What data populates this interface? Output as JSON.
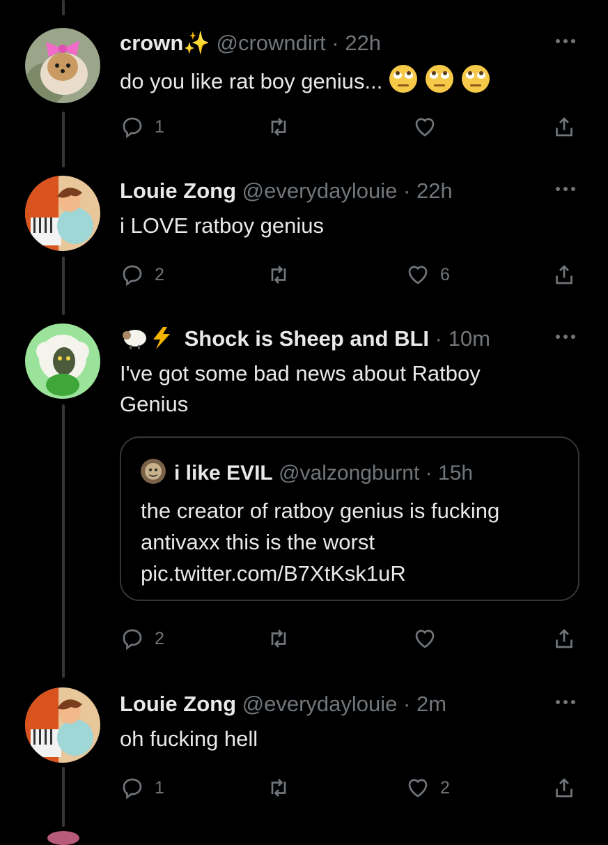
{
  "tweets": [
    {
      "name": "crown✨",
      "handle": "@crowndirt",
      "separator": "·",
      "time": "22h",
      "text": "do you like rat boy genius...",
      "emoji": "🙄🙄🙄",
      "replies": "1",
      "retweets": "",
      "likes": ""
    },
    {
      "name": "Louie Zong",
      "handle": "@everydaylouie",
      "separator": "·",
      "time": "22h",
      "text": "i LOVE ratboy genius",
      "replies": "2",
      "retweets": "",
      "likes": "6"
    },
    {
      "name_prefix": "🐏⚡",
      "name": "Shock is Sheep and BLI",
      "separator": "·",
      "time": "10m",
      "text": "I've got some bad news about Ratboy Genius",
      "replies": "2",
      "retweets": "",
      "likes": "",
      "quote": {
        "name": "i like EVIL",
        "handle": "@valzongburnt",
        "separator": "·",
        "time": "15h",
        "text": "the creator of ratboy genius is fucking antivaxx this is the worst pic.twitter.com/B7XtKsk1uR"
      }
    },
    {
      "name": "Louie Zong",
      "handle": "@everydaylouie",
      "separator": "·",
      "time": "2m",
      "text": "oh fucking hell",
      "replies": "1",
      "retweets": "",
      "likes": "2"
    }
  ],
  "colors": {
    "background": "#000000",
    "text": "#e7e9ea",
    "secondary": "#71767b",
    "border": "#333639"
  },
  "icons": [
    "reply-icon",
    "retweet-icon",
    "like-icon",
    "share-icon",
    "more-icon"
  ]
}
